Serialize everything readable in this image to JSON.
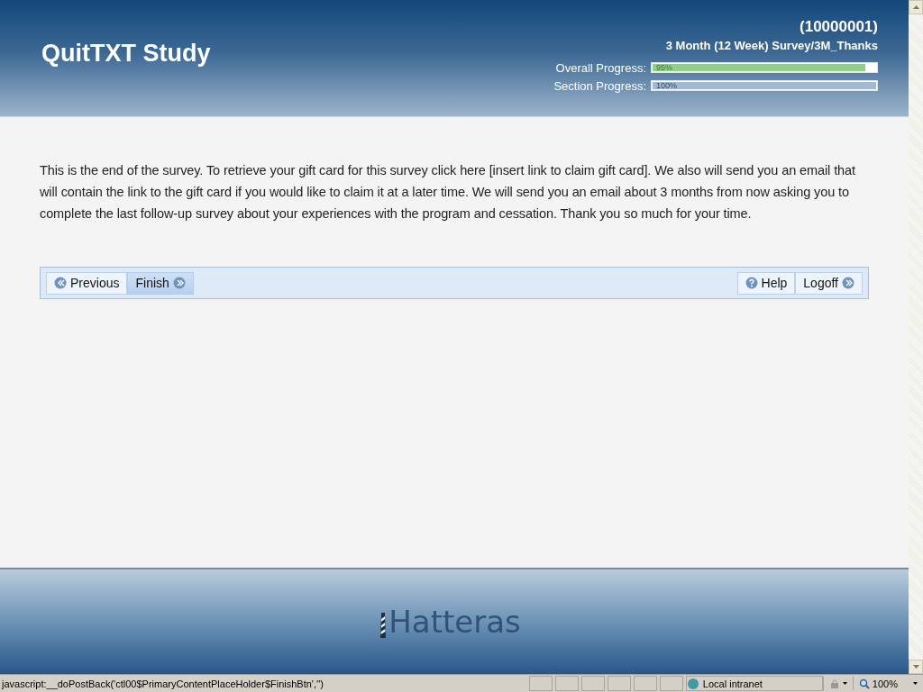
{
  "header": {
    "title": "QuitTXT Study",
    "participant_id": "(10000001)",
    "survey_path": "3 Month (12 Week) Survey/3M_Thanks",
    "progress": [
      {
        "kind": "overall",
        "label": "Overall Progress:",
        "level": 0.95,
        "reading": "95%"
      },
      {
        "kind": "section",
        "label": "Section Progress:",
        "level": 1.0,
        "reading": "100%"
      }
    ]
  },
  "message": "This is the end of the survey. To retrieve your gift card for this survey click here [insert link to claim gift card]. We also will send you an email that will contain the link to the gift card if you would like to claim it at a later time. We will send you an email about 3 months from now asking you to complete the last follow-up survey about your experiences with the program and cessation. Thank you so much for your time.",
  "nav_left": [
    {
      "kind": "back",
      "label": "Previous",
      "selected": false
    },
    {
      "kind": "forward",
      "label": "Finish",
      "selected": true
    }
  ],
  "nav_right": [
    {
      "kind": "help",
      "label": "Help",
      "selected": false
    },
    {
      "kind": "forward",
      "label": "Logoff",
      "selected": false
    }
  ],
  "footer": {
    "logo": "Hatteras"
  },
  "status_bar": {
    "text": "javascript:__doPostBack('ctl00$PrimaryContentPlaceHolder$FinishBtn','')",
    "zone": "Local intranet",
    "zoom": "100%"
  }
}
